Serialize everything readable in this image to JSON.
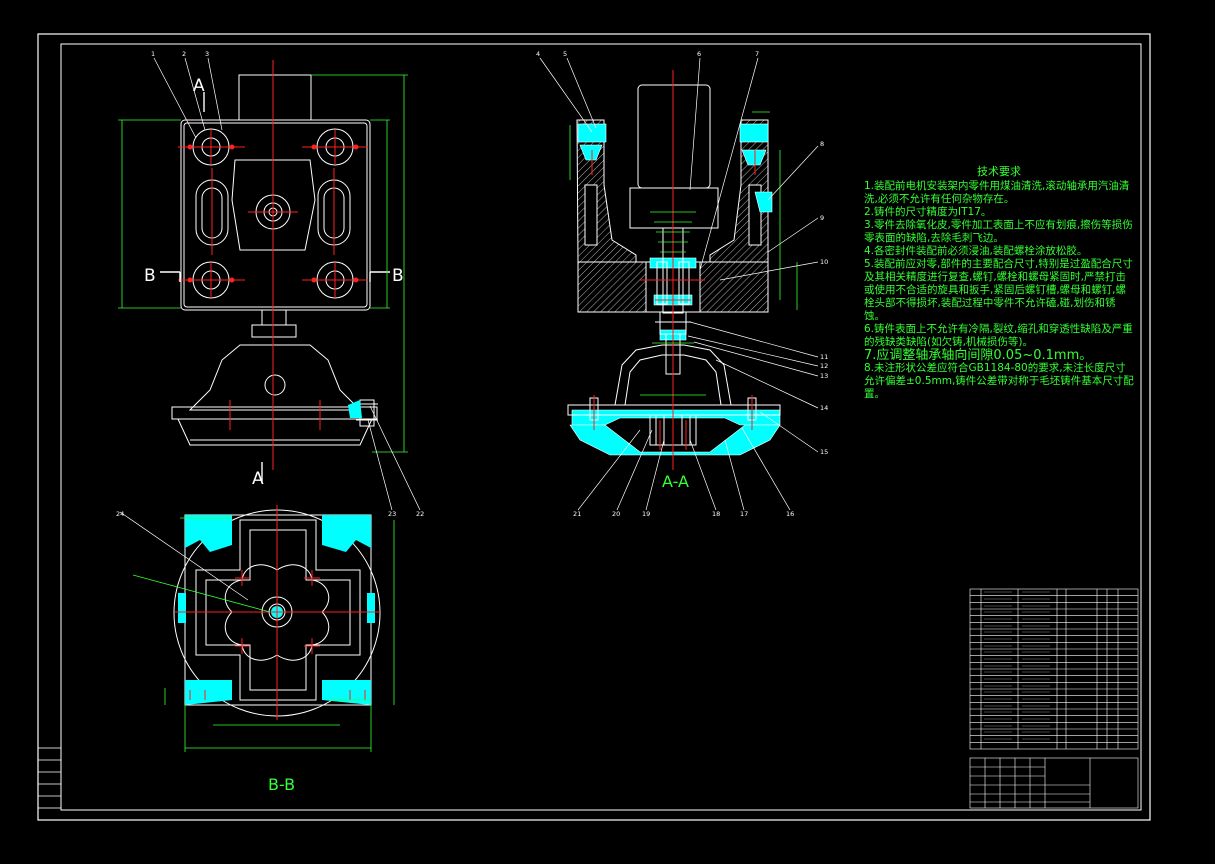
{
  "section_titles": {
    "aa": "A-A",
    "bb": "B-B"
  },
  "section_marks": {
    "a_top": "A",
    "a_bottom": "A",
    "b_left": "B",
    "b_right": "B"
  },
  "technical_requirements": {
    "title": "技术要求",
    "items": [
      "1.装配前电机安装架内零件用煤油清洗,滚动轴承用汽油清洗,必须不允许有任何杂物存在。",
      "2.铸件的尺寸精度为IT17。",
      "3.零件去除氧化皮,零件加工表面上不应有划痕,擦伤等损伤零表面的缺陷,去除毛刺飞边。",
      "4.各密封件装配前必须浸油,装配螺栓涂放松胶。",
      "5.装配前应对零,部件的主要配合尺寸,特别是过盈配合尺寸及其相关精度进行复查,螺钉,螺栓和螺母紧固时,严禁打击或使用不合适的旋具和扳手,紧固后螺钉槽,螺母和螺钉,螺栓头部不得损坏,装配过程中零件不允许磕,碰,划伤和锈蚀。",
      "6.铸件表面上不允许有冷隔,裂纹,缩孔和穿透性缺陷及严重的残缺类缺陷(如欠铸,机械损伤等)。",
      "7.应调整轴承轴向间隙0.05~0.1mm。",
      "8.未注形状公差应符合GB1184-80的要求,未注长度尺寸允许偏差±0.5mm,铸件公差带对称于毛坯铸件基本尺寸配置。"
    ]
  },
  "part_numbers": [
    "1",
    "2",
    "3",
    "4",
    "5",
    "6",
    "7",
    "8",
    "9",
    "10",
    "11",
    "12",
    "13",
    "14",
    "15",
    "16",
    "17",
    "18",
    "19",
    "20",
    "21",
    "22",
    "23",
    "24"
  ],
  "colors": {
    "background": "#000000",
    "outline": "#ffffff",
    "centerline": "#ff2020",
    "dimension": "#33ff33",
    "fill": "#00ffff",
    "leader": "#ffffff"
  }
}
